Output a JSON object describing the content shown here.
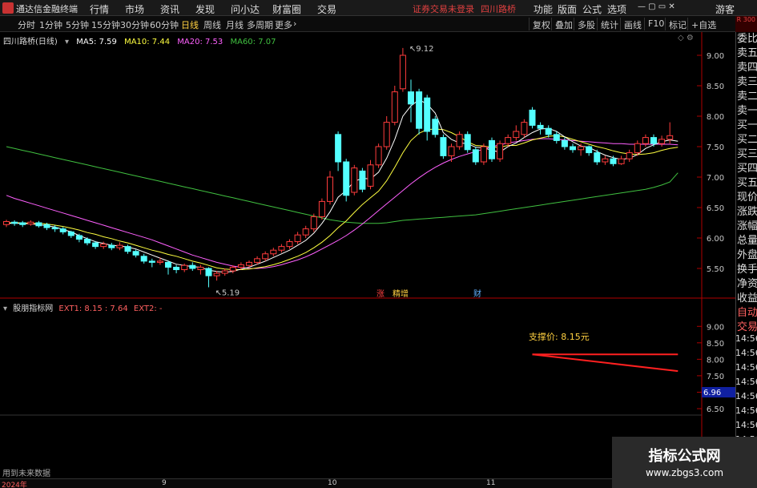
{
  "menubar": {
    "app_name": "通达信金融终端",
    "items": [
      "行情",
      "市场",
      "资讯",
      "发现",
      "问小达",
      "财富圈",
      "交易"
    ],
    "status": "证券交易未登录",
    "stock": "四川路桥",
    "right_items": [
      "功能",
      "版面",
      "公式",
      "选项"
    ],
    "guest": "游客"
  },
  "toolbar": {
    "timeframes": [
      "分时",
      "1分钟",
      "5分钟",
      "15分钟",
      "30分钟",
      "60分钟",
      "日线",
      "周线",
      "月线",
      "多周期",
      "更多"
    ],
    "active": "日线",
    "right_tools": [
      "复权",
      "叠加",
      "多股",
      "统计",
      "画线",
      "F10",
      "标记",
      "+自选"
    ]
  },
  "chart_header": {
    "title": "四川路桥(日线)",
    "ma5": "MA5: 7.59",
    "ma10": "MA10: 7.44",
    "ma20": "MA20: 7.53",
    "ma60": "MA60: 7.07"
  },
  "indicator_header": {
    "name": "股朋指标网",
    "ext1": "EXT1: 8.15 : 7.64",
    "ext2": "EXT2: -"
  },
  "colors": {
    "up": "#ff3c3c",
    "down": "#54ffff",
    "ma5": "#ffffff",
    "ma10": "#ffff40",
    "ma20": "#ff60ff",
    "ma60": "#40c040",
    "support_line": "#ff2020"
  },
  "price_axis": [
    "9.00",
    "8.50",
    "8.00",
    "7.50",
    "7.00",
    "6.50",
    "6.00",
    "5.50"
  ],
  "indicator_axis": [
    "9.00",
    "8.50",
    "8.00",
    "7.50",
    "7.00",
    "6.50"
  ],
  "indicator_current": "6.96",
  "high_label": "9.12",
  "low_label": "5.19",
  "event_tags": [
    "涨",
    "精增",
    "财"
  ],
  "support_text": "支撑价: 8.15元",
  "right_panel": [
    "委比",
    "卖五",
    "卖四",
    "卖三",
    "卖二",
    "卖一",
    "买一",
    "买二",
    "买三",
    "买四",
    "买五",
    "现价",
    "涨跌",
    "涨幅",
    "总量",
    "外盘",
    "换手",
    "净资",
    "收益",
    "自动",
    "交易"
  ],
  "right_top_badge": "R 300",
  "times": [
    "14:56",
    "14:56",
    "14:56",
    "14:56",
    "14:56",
    "14:56",
    "14:56",
    "14:56",
    "14:56",
    "14:56"
  ],
  "date_axis": [
    "2024年",
    "9",
    "10",
    "11"
  ],
  "bottom_note": "用到未来数据",
  "watermark": {
    "line1": "指标公式网",
    "line2": "www.zbgs3.com"
  },
  "chart_data": {
    "type": "candlestick",
    "title": "四川路桥(日线)",
    "ylim": [
      5.2,
      9.2
    ],
    "candles": [
      {
        "o": 6.22,
        "c": 6.27,
        "h": 6.3,
        "l": 6.18
      },
      {
        "o": 6.26,
        "c": 6.24,
        "h": 6.29,
        "l": 6.2
      },
      {
        "o": 6.25,
        "c": 6.22,
        "h": 6.28,
        "l": 6.18
      },
      {
        "o": 6.23,
        "c": 6.26,
        "h": 6.29,
        "l": 6.2
      },
      {
        "o": 6.25,
        "c": 6.2,
        "h": 6.28,
        "l": 6.17
      },
      {
        "o": 6.22,
        "c": 6.17,
        "h": 6.25,
        "l": 6.13
      },
      {
        "o": 6.17,
        "c": 6.15,
        "h": 6.21,
        "l": 6.1
      },
      {
        "o": 6.15,
        "c": 6.1,
        "h": 6.18,
        "l": 6.06
      },
      {
        "o": 6.1,
        "c": 6.04,
        "h": 6.12,
        "l": 6.0
      },
      {
        "o": 6.04,
        "c": 5.98,
        "h": 6.07,
        "l": 5.93
      },
      {
        "o": 5.98,
        "c": 5.92,
        "h": 6.01,
        "l": 5.88
      },
      {
        "o": 5.92,
        "c": 5.86,
        "h": 5.95,
        "l": 5.82
      },
      {
        "o": 5.86,
        "c": 5.9,
        "h": 5.94,
        "l": 5.82
      },
      {
        "o": 5.88,
        "c": 5.84,
        "h": 5.92,
        "l": 5.8
      },
      {
        "o": 5.84,
        "c": 5.88,
        "h": 5.93,
        "l": 5.8
      },
      {
        "o": 5.86,
        "c": 5.78,
        "h": 5.89,
        "l": 5.74
      },
      {
        "o": 5.78,
        "c": 5.72,
        "h": 5.81,
        "l": 5.68
      },
      {
        "o": 5.7,
        "c": 5.62,
        "h": 5.74,
        "l": 5.58
      },
      {
        "o": 5.62,
        "c": 5.6,
        "h": 5.66,
        "l": 5.52
      },
      {
        "o": 5.6,
        "c": 5.62,
        "h": 5.68,
        "l": 5.56
      },
      {
        "o": 5.6,
        "c": 5.52,
        "h": 5.63,
        "l": 5.4
      },
      {
        "o": 5.52,
        "c": 5.48,
        "h": 5.56,
        "l": 5.42
      },
      {
        "o": 5.48,
        "c": 5.55,
        "h": 5.58,
        "l": 5.44
      },
      {
        "o": 5.55,
        "c": 5.5,
        "h": 5.6,
        "l": 5.46
      },
      {
        "o": 5.48,
        "c": 5.52,
        "h": 5.56,
        "l": 5.4
      },
      {
        "o": 5.5,
        "c": 5.38,
        "h": 5.52,
        "l": 5.19
      },
      {
        "o": 5.38,
        "c": 5.42,
        "h": 5.46,
        "l": 5.3
      },
      {
        "o": 5.42,
        "c": 5.46,
        "h": 5.5,
        "l": 5.38
      },
      {
        "o": 5.46,
        "c": 5.52,
        "h": 5.55,
        "l": 5.42
      },
      {
        "o": 5.52,
        "c": 5.56,
        "h": 5.6,
        "l": 5.48
      },
      {
        "o": 5.55,
        "c": 5.6,
        "h": 5.63,
        "l": 5.52
      },
      {
        "o": 5.6,
        "c": 5.66,
        "h": 5.7,
        "l": 5.56
      },
      {
        "o": 5.66,
        "c": 5.74,
        "h": 5.78,
        "l": 5.62
      },
      {
        "o": 5.74,
        "c": 5.8,
        "h": 5.84,
        "l": 5.7
      },
      {
        "o": 5.8,
        "c": 5.86,
        "h": 5.9,
        "l": 5.76
      },
      {
        "o": 5.86,
        "c": 5.94,
        "h": 5.98,
        "l": 5.82
      },
      {
        "o": 5.94,
        "c": 6.05,
        "h": 6.1,
        "l": 5.9
      },
      {
        "o": 6.05,
        "c": 6.15,
        "h": 6.2,
        "l": 6.0
      },
      {
        "o": 6.15,
        "c": 6.35,
        "h": 6.4,
        "l": 6.1
      },
      {
        "o": 6.35,
        "c": 6.6,
        "h": 6.65,
        "l": 6.3
      },
      {
        "o": 6.6,
        "c": 7.0,
        "h": 7.1,
        "l": 6.55
      },
      {
        "o": 7.7,
        "c": 7.25,
        "h": 7.75,
        "l": 7.1
      },
      {
        "o": 7.25,
        "c": 6.7,
        "h": 7.3,
        "l": 6.6
      },
      {
        "o": 6.75,
        "c": 7.15,
        "h": 7.2,
        "l": 6.7
      },
      {
        "o": 7.1,
        "c": 6.8,
        "h": 7.15,
        "l": 6.75
      },
      {
        "o": 6.85,
        "c": 7.2,
        "h": 7.28,
        "l": 6.8
      },
      {
        "o": 7.2,
        "c": 7.5,
        "h": 7.55,
        "l": 7.15
      },
      {
        "o": 7.5,
        "c": 7.9,
        "h": 8.0,
        "l": 7.45
      },
      {
        "o": 7.9,
        "c": 8.4,
        "h": 8.5,
        "l": 7.85
      },
      {
        "o": 8.45,
        "c": 9.0,
        "h": 9.12,
        "l": 8.4
      },
      {
        "o": 8.4,
        "c": 8.2,
        "h": 8.6,
        "l": 7.9
      },
      {
        "o": 8.4,
        "c": 7.8,
        "h": 8.45,
        "l": 7.7
      },
      {
        "o": 8.3,
        "c": 7.75,
        "h": 8.35,
        "l": 7.6
      },
      {
        "o": 7.95,
        "c": 7.7,
        "h": 8.0,
        "l": 7.65
      },
      {
        "o": 7.65,
        "c": 7.35,
        "h": 7.7,
        "l": 7.3
      },
      {
        "o": 7.35,
        "c": 7.5,
        "h": 7.55,
        "l": 7.25
      },
      {
        "o": 7.5,
        "c": 7.7,
        "h": 7.75,
        "l": 7.45
      },
      {
        "o": 7.7,
        "c": 7.45,
        "h": 7.75,
        "l": 7.4
      },
      {
        "o": 7.45,
        "c": 7.25,
        "h": 7.5,
        "l": 7.2
      },
      {
        "o": 7.25,
        "c": 7.5,
        "h": 7.55,
        "l": 7.2
      },
      {
        "o": 7.6,
        "c": 7.3,
        "h": 7.65,
        "l": 7.25
      },
      {
        "o": 7.3,
        "c": 7.55,
        "h": 7.6,
        "l": 7.25
      },
      {
        "o": 7.55,
        "c": 7.65,
        "h": 7.7,
        "l": 7.5
      },
      {
        "o": 7.65,
        "c": 7.75,
        "h": 7.85,
        "l": 7.6
      },
      {
        "o": 7.7,
        "c": 7.9,
        "h": 7.95,
        "l": 7.65
      },
      {
        "o": 8.1,
        "c": 7.85,
        "h": 8.15,
        "l": 7.8
      },
      {
        "o": 7.85,
        "c": 7.8,
        "h": 7.9,
        "l": 7.7
      },
      {
        "o": 7.8,
        "c": 7.7,
        "h": 7.85,
        "l": 7.65
      },
      {
        "o": 7.7,
        "c": 7.6,
        "h": 7.75,
        "l": 7.55
      },
      {
        "o": 7.6,
        "c": 7.5,
        "h": 7.65,
        "l": 7.45
      },
      {
        "o": 7.5,
        "c": 7.45,
        "h": 7.55,
        "l": 7.4
      },
      {
        "o": 7.45,
        "c": 7.5,
        "h": 7.55,
        "l": 7.35
      },
      {
        "o": 7.5,
        "c": 7.4,
        "h": 7.52,
        "l": 7.35
      },
      {
        "o": 7.4,
        "c": 7.25,
        "h": 7.45,
        "l": 7.2
      },
      {
        "o": 7.25,
        "c": 7.3,
        "h": 7.35,
        "l": 7.2
      },
      {
        "o": 7.3,
        "c": 7.22,
        "h": 7.35,
        "l": 7.18
      },
      {
        "o": 7.22,
        "c": 7.3,
        "h": 7.35,
        "l": 7.2
      },
      {
        "o": 7.3,
        "c": 7.4,
        "h": 7.45,
        "l": 7.25
      },
      {
        "o": 7.4,
        "c": 7.55,
        "h": 7.6,
        "l": 7.35
      },
      {
        "o": 7.55,
        "c": 7.65,
        "h": 7.7,
        "l": 7.5
      },
      {
        "o": 7.65,
        "c": 7.55,
        "h": 7.7,
        "l": 7.5
      },
      {
        "o": 7.55,
        "c": 7.62,
        "h": 7.68,
        "l": 7.5
      },
      {
        "o": 7.62,
        "c": 7.68,
        "h": 7.9,
        "l": 7.55
      }
    ],
    "ma5": [
      6.24,
      6.24,
      6.24,
      6.23,
      6.22,
      6.2,
      6.18,
      6.14,
      6.1,
      6.04,
      5.99,
      5.94,
      5.91,
      5.88,
      5.87,
      5.85,
      5.82,
      5.77,
      5.72,
      5.67,
      5.62,
      5.57,
      5.55,
      5.53,
      5.52,
      5.47,
      5.45,
      5.44,
      5.45,
      5.49,
      5.52,
      5.57,
      5.62,
      5.68,
      5.74,
      5.8,
      5.88,
      5.96,
      6.08,
      6.24,
      6.43,
      6.67,
      6.78,
      6.93,
      6.98,
      6.97,
      7.08,
      7.31,
      7.62,
      8.0,
      8.17,
      8.27,
      8.2,
      8.05,
      7.73,
      7.62,
      7.56,
      7.55,
      7.49,
      7.48,
      7.44,
      7.41,
      7.5,
      7.56,
      7.65,
      7.73,
      7.79,
      7.8,
      7.75,
      7.66,
      7.58,
      7.51,
      7.49,
      7.42,
      7.36,
      7.32,
      7.29,
      7.31,
      7.37,
      7.47,
      7.53,
      7.58,
      7.61,
      7.59
    ],
    "ma10": [
      6.25,
      6.25,
      6.25,
      6.24,
      6.24,
      6.23,
      6.21,
      6.19,
      6.16,
      6.13,
      6.09,
      6.06,
      6.02,
      5.99,
      5.95,
      5.92,
      5.88,
      5.84,
      5.8,
      5.77,
      5.73,
      5.7,
      5.66,
      5.62,
      5.59,
      5.55,
      5.51,
      5.49,
      5.48,
      5.48,
      5.49,
      5.51,
      5.53,
      5.56,
      5.6,
      5.65,
      5.7,
      5.76,
      5.84,
      5.93,
      6.04,
      6.17,
      6.28,
      6.42,
      6.55,
      6.66,
      6.77,
      6.94,
      7.16,
      7.4,
      7.6,
      7.72,
      7.78,
      7.79,
      7.78,
      7.73,
      7.66,
      7.58,
      7.52,
      7.51,
      7.49,
      7.49,
      7.52,
      7.52,
      7.56,
      7.61,
      7.64,
      7.67,
      7.68,
      7.66,
      7.62,
      7.58,
      7.54,
      7.5,
      7.47,
      7.43,
      7.4,
      7.38,
      7.37,
      7.38,
      7.4,
      7.44,
      7.47,
      7.49
    ],
    "ma20": [
      6.7,
      6.65,
      6.61,
      6.57,
      6.53,
      6.49,
      6.45,
      6.41,
      6.37,
      6.33,
      6.29,
      6.25,
      6.21,
      6.17,
      6.13,
      6.09,
      6.05,
      6.01,
      5.97,
      5.92,
      5.87,
      5.82,
      5.77,
      5.72,
      5.68,
      5.64,
      5.6,
      5.57,
      5.54,
      5.52,
      5.5,
      5.5,
      5.51,
      5.53,
      5.56,
      5.6,
      5.64,
      5.69,
      5.75,
      5.82,
      5.89,
      5.96,
      6.04,
      6.13,
      6.23,
      6.34,
      6.45,
      6.56,
      6.67,
      6.78,
      6.89,
      6.99,
      7.08,
      7.16,
      7.23,
      7.29,
      7.34,
      7.38,
      7.42,
      7.46,
      7.5,
      7.53,
      7.56,
      7.58,
      7.6,
      7.62,
      7.63,
      7.63,
      7.62,
      7.61,
      7.6,
      7.59,
      7.58,
      7.57,
      7.56,
      7.55,
      7.55,
      7.54,
      7.54,
      7.54,
      7.54,
      7.54,
      7.54,
      7.53
    ],
    "ma60": [
      7.5,
      7.47,
      7.44,
      7.41,
      7.38,
      7.35,
      7.32,
      7.29,
      7.26,
      7.23,
      7.2,
      7.17,
      7.14,
      7.11,
      7.08,
      7.05,
      7.02,
      6.99,
      6.96,
      6.93,
      6.9,
      6.87,
      6.84,
      6.81,
      6.78,
      6.75,
      6.72,
      6.69,
      6.66,
      6.63,
      6.6,
      6.57,
      6.54,
      6.51,
      6.48,
      6.45,
      6.42,
      6.39,
      6.36,
      6.33,
      6.3,
      6.28,
      6.26,
      6.25,
      6.24,
      6.24,
      6.24,
      6.25,
      6.27,
      6.29,
      6.3,
      6.31,
      6.32,
      6.33,
      6.34,
      6.35,
      6.36,
      6.37,
      6.38,
      6.4,
      6.42,
      6.44,
      6.46,
      6.48,
      6.5,
      6.52,
      6.54,
      6.56,
      6.58,
      6.6,
      6.62,
      6.64,
      6.66,
      6.68,
      6.7,
      6.72,
      6.74,
      6.76,
      6.78,
      6.8,
      6.83,
      6.87,
      6.92,
      7.07
    ],
    "support": {
      "level": 8.15,
      "ind_ylim": [
        6.5,
        9.25
      ],
      "start_candle": 65,
      "end_candle": 83,
      "upper": [
        8.15,
        8.15
      ],
      "lower": [
        8.15,
        7.64
      ]
    }
  }
}
